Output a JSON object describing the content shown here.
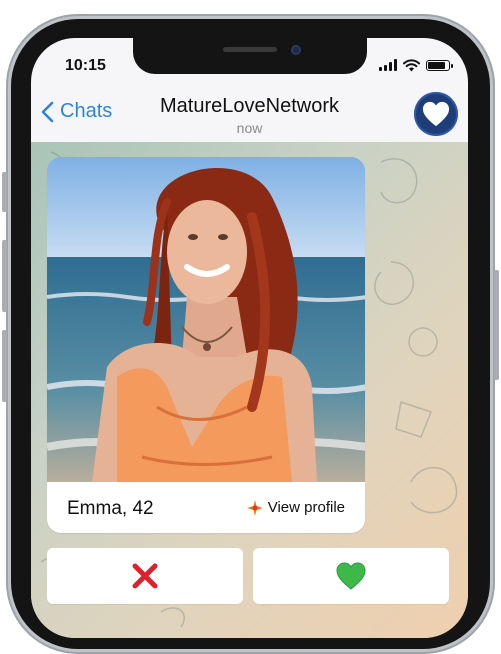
{
  "status_bar": {
    "time": "10:15",
    "battery_level": 0.85
  },
  "header": {
    "back_label": "Chats",
    "title": "MatureLoveNetwork",
    "subtitle": "now",
    "avatar_icon": "heart-icon"
  },
  "profile_card": {
    "name": "Emma, 42",
    "view_profile_label": "View profile",
    "view_profile_icon": "sparkle-icon",
    "photo": "woman-on-beach-photo"
  },
  "actions": {
    "reject_icon": "red-x-icon",
    "like_icon": "green-heart-icon"
  },
  "colors": {
    "accent_blue": "#2f84d6",
    "avatar_bg": "#1f3d78",
    "reject_red": "#e0202a",
    "like_green": "#3fb84a",
    "dress_orange": "#f39a5c"
  }
}
